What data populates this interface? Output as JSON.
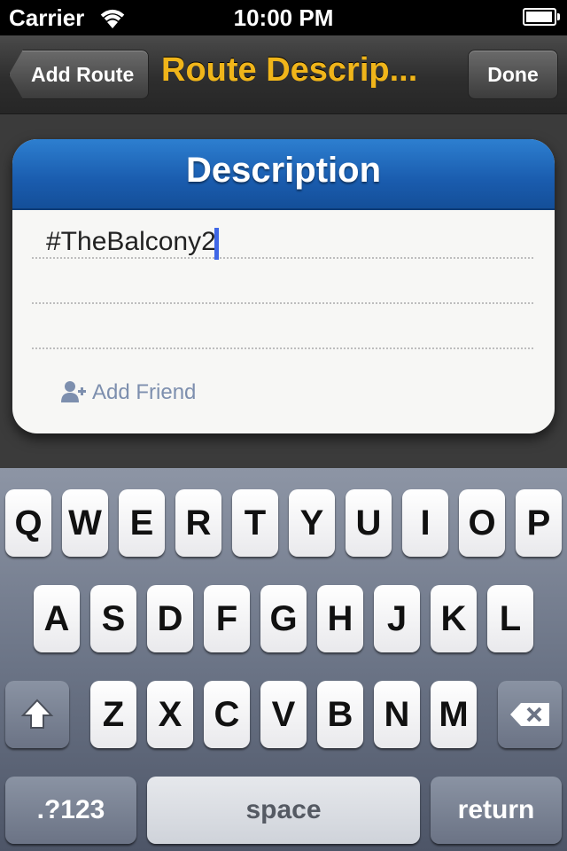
{
  "status_bar": {
    "carrier": "Carrier",
    "time": "10:00 PM",
    "battery_level": 0.95
  },
  "nav": {
    "back_label": "Add Route",
    "title": "Route Descrip...",
    "done_label": "Done"
  },
  "card": {
    "title": "Description",
    "text_value": "#TheBalcony2",
    "add_friend_label": "Add Friend"
  },
  "keyboard": {
    "row1": [
      "Q",
      "W",
      "E",
      "R",
      "T",
      "Y",
      "U",
      "I",
      "O",
      "P"
    ],
    "row2": [
      "A",
      "S",
      "D",
      "F",
      "G",
      "H",
      "J",
      "K",
      "L"
    ],
    "row3": [
      "Z",
      "X",
      "C",
      "V",
      "B",
      "N",
      "M"
    ],
    "numbers_label": ".?123",
    "space_label": "space",
    "return_label": "return"
  },
  "colors": {
    "accent_title": "#f0b51a",
    "header_blue": "#1a5cae",
    "caret": "#3f67e6"
  }
}
